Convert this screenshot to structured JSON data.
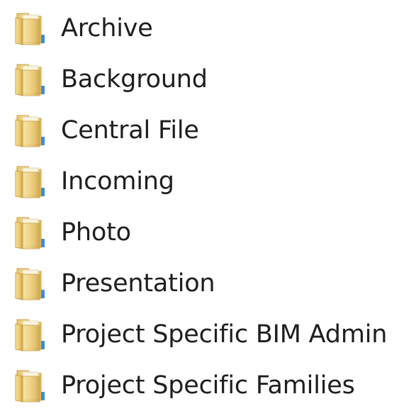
{
  "folders": [
    {
      "name": "Archive",
      "icon": "folder-icon"
    },
    {
      "name": "Background",
      "icon": "folder-icon"
    },
    {
      "name": "Central File",
      "icon": "folder-icon"
    },
    {
      "name": "Incoming",
      "icon": "folder-icon"
    },
    {
      "name": "Photo",
      "icon": "folder-icon"
    },
    {
      "name": "Presentation",
      "icon": "folder-icon"
    },
    {
      "name": "Project Specific BIM Admin",
      "icon": "folder-icon"
    },
    {
      "name": "Project Specific Families",
      "icon": "folder-icon"
    }
  ],
  "colors": {
    "folder_light": "#f7e3a0",
    "folder_mid": "#e9c56a",
    "folder_dark": "#c9a04a",
    "folder_paper": "#fbf4dc",
    "accent_blue": "#3b8fd8",
    "text": "#1e1e1e"
  }
}
